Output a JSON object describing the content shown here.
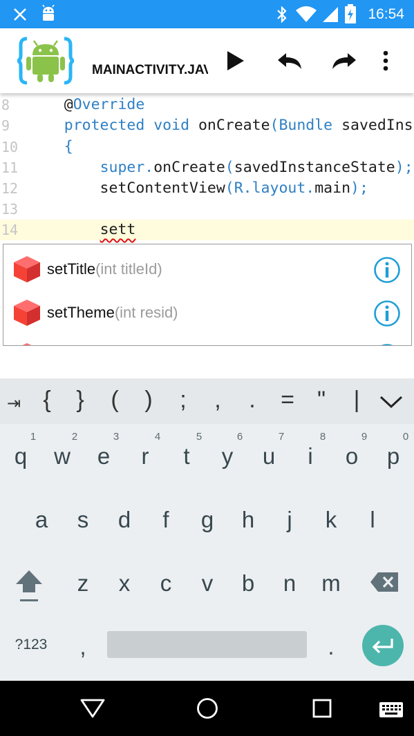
{
  "status_bar": {
    "time": "16:54",
    "icons": [
      "close-icon",
      "android-debug-icon",
      "bluetooth-icon",
      "wifi-icon",
      "signal-icon",
      "battery-charging-icon"
    ]
  },
  "app_bar": {
    "title": "MAINACTIVITY.JAVA",
    "actions": [
      "play-icon",
      "undo-icon",
      "redo-icon",
      "more-vert-icon"
    ]
  },
  "editor": {
    "current_line": 14,
    "lines": [
      {
        "num": "8",
        "text": "    @Override"
      },
      {
        "num": "9",
        "text": "    protected void onCreate(Bundle savedInstanceState)"
      },
      {
        "num": "10",
        "text": "    {"
      },
      {
        "num": "11",
        "text": "        super.onCreate(savedInstanceState);"
      },
      {
        "num": "12",
        "text": "        setContentView(R.layout.main);"
      },
      {
        "num": "13",
        "text": ""
      },
      {
        "num": "14",
        "text": "        sett"
      }
    ]
  },
  "autocomplete": {
    "items": [
      {
        "name": "setTitle",
        "signature": "(int titleId)"
      },
      {
        "name": "setTheme",
        "signature": "(int resid)"
      }
    ]
  },
  "keyboard": {
    "symbol_row": [
      "⇥",
      "{",
      "}",
      "(",
      ")",
      ";",
      ",",
      ".",
      "=",
      "\"",
      "|"
    ],
    "row1": [
      "q",
      "w",
      "e",
      "r",
      "t",
      "y",
      "u",
      "i",
      "o",
      "p"
    ],
    "row1_hints": [
      "1",
      "2",
      "3",
      "4",
      "5",
      "6",
      "7",
      "8",
      "9",
      "0"
    ],
    "row2": [
      "a",
      "s",
      "d",
      "f",
      "g",
      "h",
      "j",
      "k",
      "l"
    ],
    "row3": [
      "z",
      "x",
      "c",
      "v",
      "b",
      "n",
      "m"
    ],
    "mode_label": "?123",
    "comma": ",",
    "period": "."
  },
  "colors": {
    "status_bar": "#2196F3",
    "keyword": "#2F80C4",
    "current_line": "#FFFBDD",
    "cube": "#F44336",
    "info": "#1E9FD6",
    "enter_key": "#4DB6AC"
  }
}
